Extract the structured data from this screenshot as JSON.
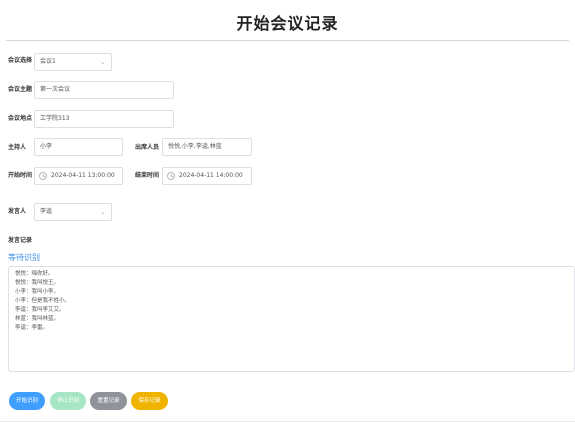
{
  "page": {
    "title": "开始会议记录"
  },
  "form": {
    "meeting_select": {
      "label": "会议选择",
      "value": "会议1"
    },
    "topic": {
      "label": "会议主题",
      "value": "第一次会议"
    },
    "location": {
      "label": "会议地点",
      "value": "工学院313"
    },
    "host": {
      "label": "主持人",
      "value": "小李"
    },
    "attendees": {
      "label": "出席人员",
      "value": "悦悦,小李,李逵,林蓝"
    },
    "start_time": {
      "label": "开始时间",
      "value": "2024-04-11 13:00:00"
    },
    "end_time": {
      "label": "结束时间",
      "value": "2024-04-11 14:00:00"
    },
    "speaker": {
      "label": "发言人",
      "value": "李逵"
    }
  },
  "record": {
    "label": "发言记录",
    "status": "等待识别",
    "lines": [
      "悦悦：嗨你好。",
      "悦悦：我叫悦王。",
      "小李：我叫小李。",
      "小李：但是我不姓小。",
      "李逵：我叫李艾艾。",
      "林蓝：我叫林蓝。",
      "李逵：李雷。"
    ]
  },
  "actions": {
    "start": "开始识别",
    "stop": "停止识别",
    "reset": "重置记录",
    "save": "保存记录"
  }
}
